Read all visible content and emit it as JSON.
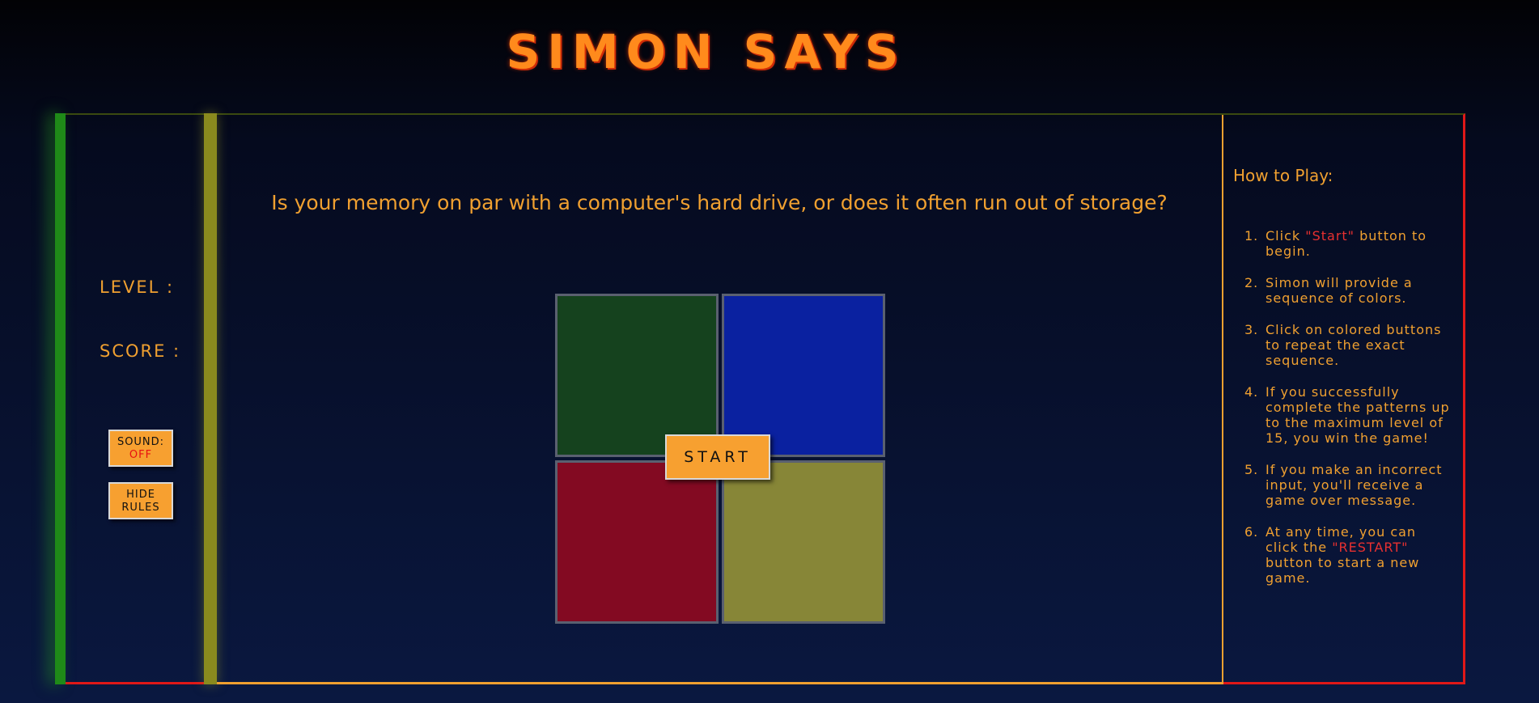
{
  "title": "SIMON SAYS",
  "question": "Is your memory on par with a computer's hard drive, or does it often run out of storage?",
  "stats": {
    "level_label": "LEVEL :",
    "score_label": "SCORE :"
  },
  "controls": {
    "sound_label": "SOUND:",
    "sound_state": "OFF",
    "hide_rules_label": "HIDE RULES",
    "start_label": "START"
  },
  "pads": [
    {
      "color_name": "green",
      "color": "#15421e"
    },
    {
      "color_name": "blue",
      "color": "#0a21a0"
    },
    {
      "color_name": "red",
      "color": "#830a22"
    },
    {
      "color_name": "yellow",
      "color": "#878637"
    }
  ],
  "rules": {
    "title": "How to Play:",
    "items": [
      {
        "num": "1.",
        "before": "Click ",
        "highlight": "\"Start\"",
        "after": " button to begin."
      },
      {
        "num": "2.",
        "before": "Simon will provide a sequence of colors.",
        "highlight": "",
        "after": ""
      },
      {
        "num": "3.",
        "before": "Click on colored buttons to repeat the exact sequence.",
        "highlight": "",
        "after": ""
      },
      {
        "num": "4.",
        "before": "If you successfully complete the patterns up to the maximum level of 15, you win the game!",
        "highlight": "",
        "after": ""
      },
      {
        "num": "5.",
        "before": "If you make an incorrect input, you'll receive a game over message.",
        "highlight": "",
        "after": ""
      },
      {
        "num": "6.",
        "before": "At any time, you can click the ",
        "highlight": "\"RESTART\"",
        "after": " button to start a new game."
      }
    ]
  },
  "colors": {
    "accent": "#f0a030",
    "button_bg": "#f7a030",
    "highlight": "#e83030",
    "border_red": "#e01818",
    "bar_green": "#1f8a18",
    "bar_olive": "#8a8a1e"
  }
}
